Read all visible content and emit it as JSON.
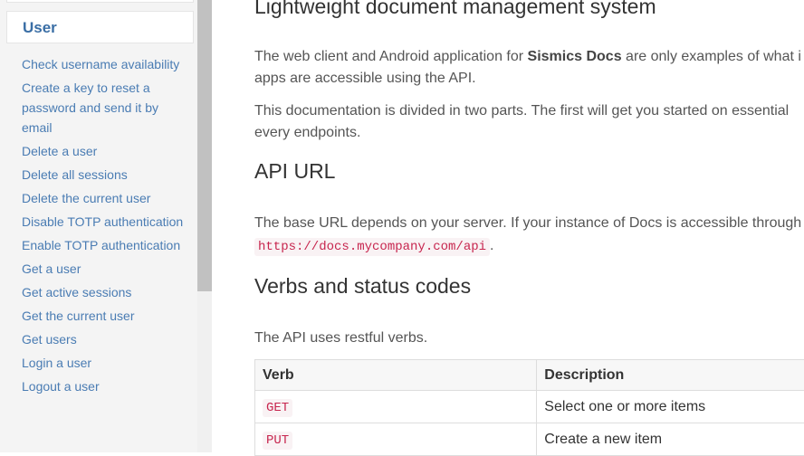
{
  "sidebar": {
    "section": "User",
    "items": [
      "Check username availability",
      "Create a key to reset a password and send it by email",
      "Delete a user",
      "Delete all sessions",
      "Delete the current user",
      "Disable TOTP authentication",
      "Enable TOTP authentication",
      "Get a user",
      "Get active sessions",
      "Get the current user",
      "Get users",
      "Login a user",
      "Logout a user"
    ]
  },
  "main": {
    "title": "Lightweight document management system",
    "intro1a": "The web client and Android application for ",
    "intro1b": "Sismics Docs",
    "intro1c": " are only examples of what i",
    "intro1d": "apps are accessible using the API.",
    "intro2a": "This documentation is divided in two parts. The first will get you started on essential",
    "intro2b": "every endpoints.",
    "api_url_heading": "API URL",
    "api_url_text": "The base URL depends on your server. If your instance of Docs is accessible through",
    "api_url_code": "https://docs.mycompany.com/api",
    "verbs_heading": "Verbs and status codes",
    "verbs_text": "The API uses restful verbs.",
    "table": {
      "headers": [
        "Verb",
        "Description"
      ],
      "rows": [
        [
          "GET",
          "Select one or more items"
        ],
        [
          "PUT",
          "Create a new item"
        ]
      ]
    }
  }
}
